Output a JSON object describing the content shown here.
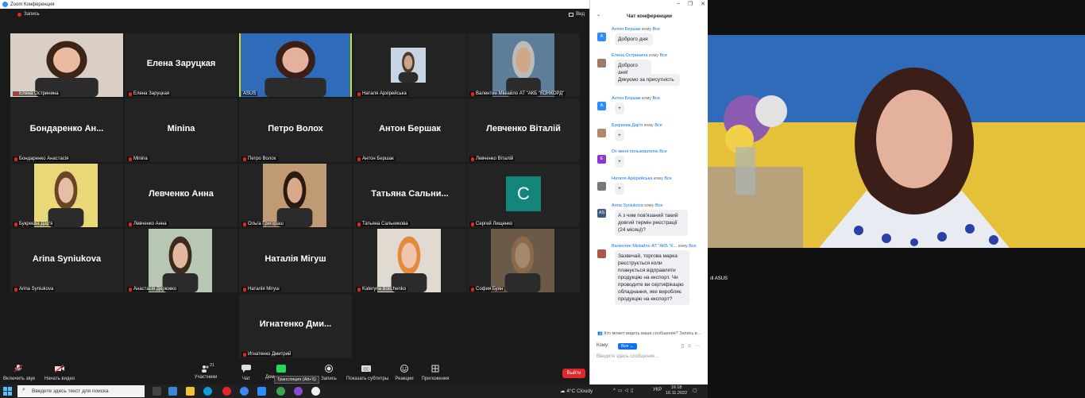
{
  "window": {
    "title": "Zoom Конференция"
  },
  "top_bar": {
    "record": "Запись",
    "view": "Вид"
  },
  "participants": [
    {
      "name": "Елена Остринина",
      "big": ""
    },
    {
      "name": "Елена Заруцкая",
      "big": "Елена Заруцкая"
    },
    {
      "name": "ASUS",
      "big": ""
    },
    {
      "name": "Наталя Архірейська",
      "big": ""
    },
    {
      "name": "Валентин Мініайло АТ \"АКБ \"КОНКОРД\"",
      "big": ""
    },
    {
      "name": "Бондаренко Анастасія",
      "big": "Бондаренко Ан..."
    },
    {
      "name": "Minina",
      "big": "Minina"
    },
    {
      "name": "Петро Волох",
      "big": "Петро Волох"
    },
    {
      "name": "Антон Бершак",
      "big": "Антон Бершак"
    },
    {
      "name": "Левченко Віталій",
      "big": "Левченко Віталій"
    },
    {
      "name": "Букреєва Дар'я",
      "big": ""
    },
    {
      "name": "Левченко Анна",
      "big": "Левченко Анна"
    },
    {
      "name": "Ольга Григораш",
      "big": ""
    },
    {
      "name": "Татьяна Сальникова",
      "big": "Татьяна Сальни..."
    },
    {
      "name": "Сергей Лищенко",
      "big": ""
    },
    {
      "name": "Arina Syniukova",
      "big": "Arina Syniukova"
    },
    {
      "name": "Анастасія Дерюжко",
      "big": ""
    },
    {
      "name": "Наталія Мігуш",
      "big": "Наталія Мігуш"
    },
    {
      "name": "Kateryna Bolichenko",
      "big": ""
    },
    {
      "name": "София Буян",
      "big": ""
    },
    {
      "name": "Игнатенко Дмитрий",
      "big": "Игнатенко Дми..."
    }
  ],
  "initial_tile": "C",
  "toolbar": {
    "unmute": "Включить звук",
    "start_video": "Начать видео",
    "participants": "Участники",
    "participants_count": "21",
    "chat": "Чат",
    "share": "Дем",
    "broadcast_tip": "Трансляция (Alt+S)",
    "record": "Запись",
    "subtitles": "Показать субтитры",
    "reactions": "Реакции",
    "apps": "Приложения",
    "leave": "Выйти"
  },
  "chat": {
    "title": "Чат конференции",
    "messages": [
      {
        "sender": "Антон Бершак",
        "to": "кому",
        "target": "Все",
        "avatar": "A",
        "bubbles": [
          "Доброго дня"
        ]
      },
      {
        "sender": "Елена Остринина",
        "to": "кому",
        "target": "Все",
        "avatar": "",
        "bubbles": [
          "Доброго дня!",
          "Дякуємо за присутність"
        ]
      },
      {
        "sender": "Антон Бершак",
        "to": "кому",
        "target": "Все",
        "avatar": "A",
        "bubbles": [
          "+"
        ]
      },
      {
        "sender": "Букреева Дар'я",
        "to": "кому",
        "target": "Все",
        "avatar": "",
        "bubbles": [
          "+"
        ]
      },
      {
        "sender": "От меня пользователю",
        "to": "",
        "target": "Все",
        "avatar": "E",
        "bubbles": [
          "+"
        ]
      },
      {
        "sender": "Наталя Архірейська",
        "to": "кому",
        "target": "Все",
        "avatar": "",
        "bubbles": [
          "+"
        ]
      },
      {
        "sender": "Arina Syniukova",
        "to": "кому",
        "target": "Все",
        "avatar": "AS",
        "bubbles": [
          "А з чим пов'язаний такий довгий термін реєстрації (24 місяці)?"
        ]
      },
      {
        "sender": "Валентин Мініайло АТ \"АКБ \"К...",
        "to": "кому",
        "target": "Все",
        "avatar": "",
        "bubbles": [
          "Зазвичай, торгова марка реєструється коли планується відправляти продукцію на експорт. Чи проводите ви сертифікацію обладнання, яке виробляє продукцію на експорт?"
        ]
      }
    ],
    "who_can_see": "Кто может видеть ваши сообщения? Запись в...",
    "to_label": "Кому:",
    "to_value": "Все",
    "input_placeholder": "Введите здесь сообщение..."
  },
  "speaker": {
    "label": "ASUS"
  },
  "taskbar": {
    "search": "Введите здесь текст для поиска",
    "weather": "4°C  Cloudy",
    "lang": "УКР",
    "time": "16:18",
    "date": "16.11.2022"
  },
  "colors": {
    "accent": "#0e72ed",
    "leave": "#e02828",
    "active_speaker": "#c6e02f",
    "initial_tile": "#13857a"
  }
}
